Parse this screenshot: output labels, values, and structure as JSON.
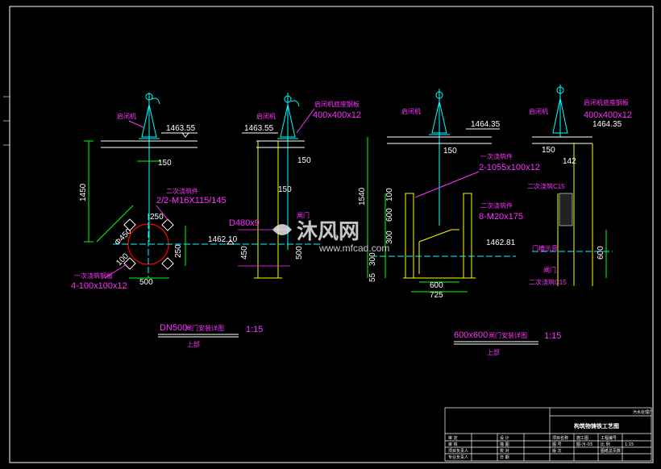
{
  "views": {
    "v1": {
      "elev": "1463.55",
      "w150": "150",
      "h1450": "1450",
      "note_part": "二次浇筑件",
      "note_spec": "2/2-M16X115/145",
      "d250": "250",
      "d500": "500",
      "d450": "Φ450",
      "d100": "100",
      "elev_pipe": "1462.10",
      "note_plate": "一次浇筑钢板",
      "note_plate_spec": "4-100x100x12",
      "d250b": "250",
      "hoist": "启闭机"
    },
    "v2": {
      "elev": "1463.55",
      "w150": "150",
      "w150b": "150",
      "hoist": "启闭机",
      "plate_label": "启闭机底座钢板",
      "plate_spec": "400x400x12",
      "d480": "D480x9",
      "gate": "闸门",
      "d450": "450",
      "d500": "500"
    },
    "v3": {
      "elev": "1464.35",
      "w150": "150",
      "h1540": "1540",
      "hoist": "启闭机",
      "note_part": "一次浇筑件",
      "note_spec": "2-1055x100x12",
      "note_part2": "二次浇筑件",
      "note_spec2": "8-M20x175",
      "d100": "100",
      "d600v": "600",
      "d300": "300",
      "d300b": "300",
      "d55": "55",
      "elev_pipe": "1462.81",
      "d600": "600",
      "d725": "725"
    },
    "v4": {
      "elev": "1464.35",
      "w150": "150",
      "d142": "142",
      "hoist": "启闭机",
      "plate_label": "启闭机底座钢板",
      "plate_spec": "400x400x12",
      "conc1": "二次浇筑C15",
      "gate": "闸门",
      "conc2": "二次浇筑C15",
      "d600": "600",
      "side": "门槽示意"
    }
  },
  "captions": {
    "left_title": "DN500",
    "left_title_sub": "闸门安装详图",
    "left_scale": "1:15",
    "left_sub": "上部",
    "right_title": "600x600",
    "right_title_sub": "闸门安装详图",
    "right_scale": "1:15",
    "right_sub": "上部"
  },
  "watermark": {
    "cn": "沐风网",
    "url": "www.mfcad.com"
  },
  "title_block": {
    "org": "污水处理厂",
    "drawing": "构筑物铸铁工艺图",
    "rows": [
      [
        "审 定",
        "",
        "设 计",
        ""
      ],
      [
        "审 核",
        "",
        "描 图",
        ""
      ],
      [
        "项目负责人",
        "",
        "校 对",
        ""
      ],
      [
        "专业负责人",
        "",
        "日 期",
        ""
      ]
    ],
    "right_rows": [
      [
        "项目名称",
        "施工图",
        "工程编号",
        ""
      ],
      [
        "图 号",
        "图-污-03",
        "比 例",
        "1:15"
      ],
      [
        "版 次",
        "",
        "图纸总页数",
        ""
      ]
    ]
  },
  "colors": {
    "frame": "#ffffff",
    "cyan": "#00ffff",
    "green": "#00ff00",
    "yellow": "#ffff00",
    "magenta": "#ff33ff",
    "red": "#ff0000"
  }
}
